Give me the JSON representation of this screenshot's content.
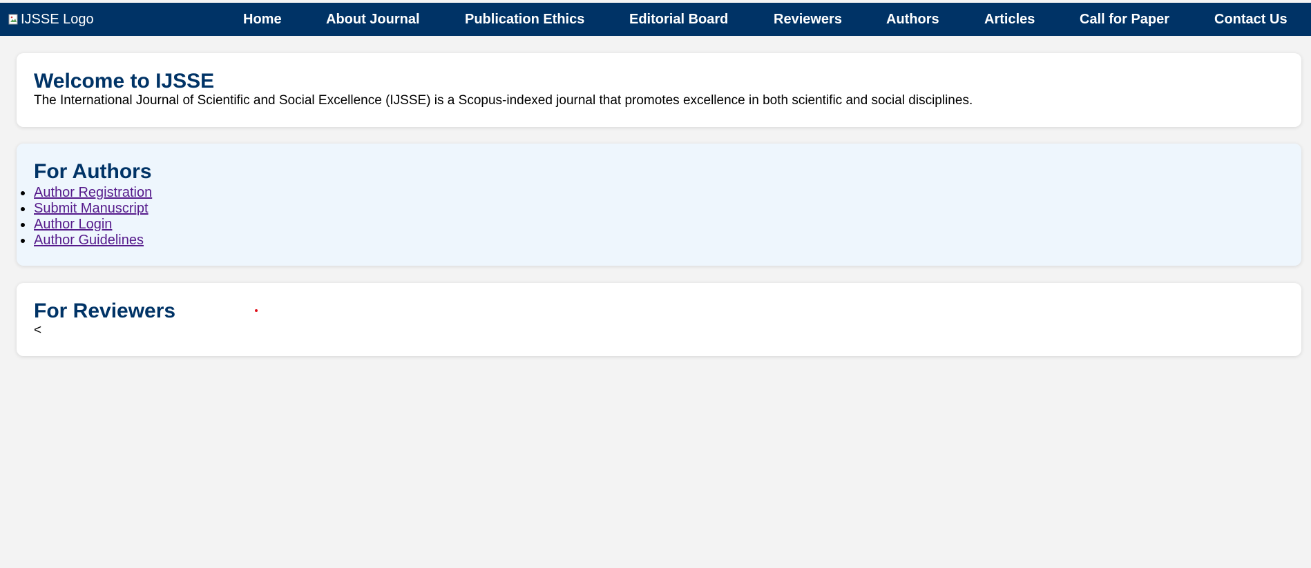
{
  "header": {
    "logo_alt": "IJSSE Logo",
    "nav": [
      {
        "label": "Home"
      },
      {
        "label": "About Journal"
      },
      {
        "label": "Publication Ethics"
      },
      {
        "label": "Editorial Board"
      },
      {
        "label": "Reviewers"
      },
      {
        "label": "Authors"
      },
      {
        "label": "Articles"
      },
      {
        "label": "Call for Paper"
      },
      {
        "label": "Contact Us"
      }
    ]
  },
  "welcome": {
    "title": "Welcome to IJSSE",
    "text": "The International Journal of Scientific and Social Excellence (IJSSE) is a Scopus-indexed journal that promotes excellence in both scientific and social disciplines."
  },
  "authors": {
    "title": "For Authors",
    "links": [
      {
        "label": "Author Registration"
      },
      {
        "label": "Submit Manuscript"
      },
      {
        "label": "Author Login"
      },
      {
        "label": "Author Guidelines"
      }
    ]
  },
  "reviewers": {
    "title": "For Reviewers",
    "stray_text": "<"
  },
  "colors": {
    "header_bg": "#003366",
    "heading": "#003366",
    "link_visited": "#551a8b",
    "page_bg": "#f3f3f3",
    "authors_card_bg": "#eef6fd"
  }
}
